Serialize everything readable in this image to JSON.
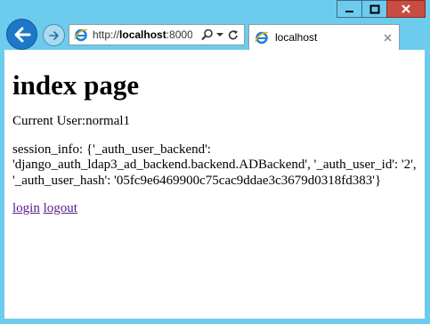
{
  "browser": {
    "address": {
      "prefix": "http://",
      "host": "localhost",
      "rest": ":8000/"
    },
    "tab_title": "localhost"
  },
  "page": {
    "heading": "index page",
    "current_user_label": "Current User:",
    "current_user": "normal1",
    "session_info": "session_info: {'_auth_user_backend': 'django_auth_ldap3_ad_backend.backend.ADBackend', '_auth_user_id': '2', '_auth_user_hash': '05fc9e6469900c75cac9ddae3c3679d0318fd383'}",
    "links": {
      "login": "login",
      "logout": "logout"
    }
  },
  "colors": {
    "frame": "#6dcbee",
    "close_button": "#c74d42",
    "back_button": "#1d78c8",
    "visited_link": "#551a8b"
  }
}
